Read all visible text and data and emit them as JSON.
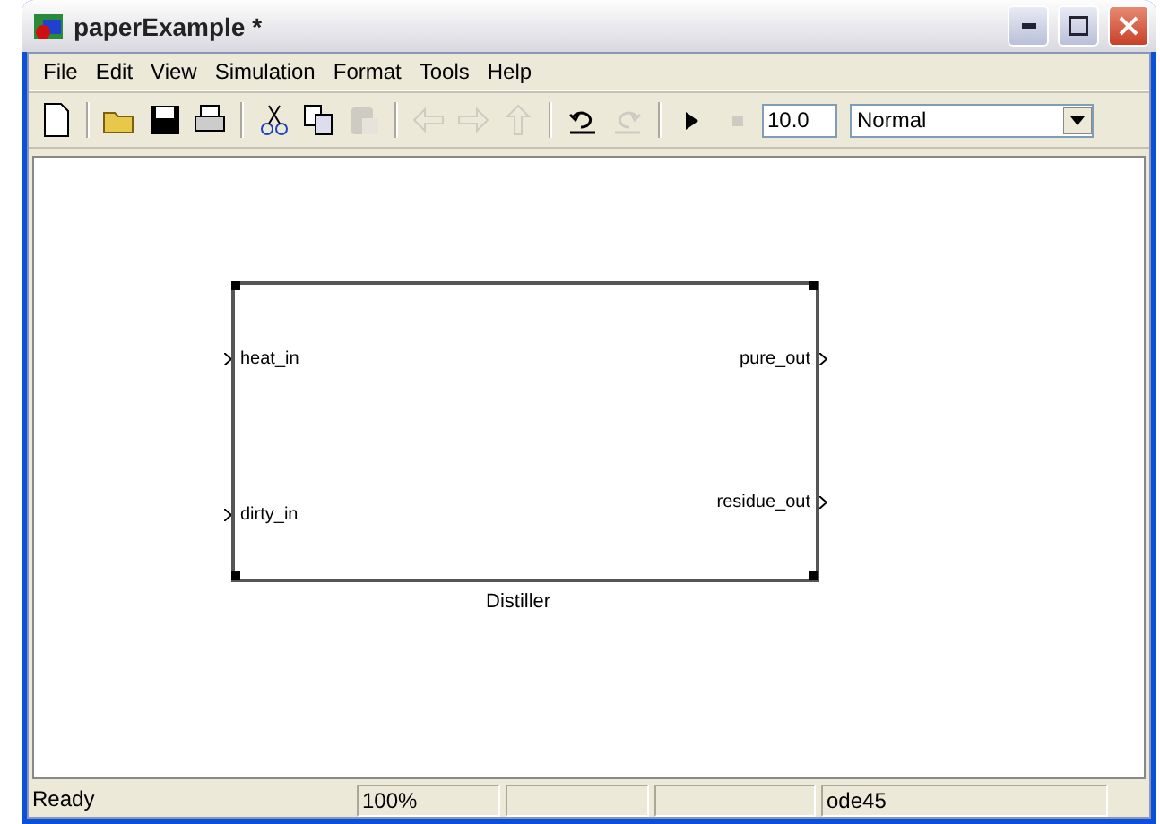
{
  "window": {
    "title": "paperExample *"
  },
  "menu": [
    "File",
    "Edit",
    "View",
    "Simulation",
    "Format",
    "Tools",
    "Help"
  ],
  "toolbar": [
    {
      "kind": "new",
      "disabled": false
    },
    {
      "kind": "sep"
    },
    {
      "kind": "open",
      "disabled": false
    },
    {
      "kind": "save",
      "disabled": false
    },
    {
      "kind": "print",
      "disabled": false
    },
    {
      "kind": "sep"
    },
    {
      "kind": "cut",
      "disabled": false
    },
    {
      "kind": "copy",
      "disabled": false
    },
    {
      "kind": "paste",
      "disabled": true
    },
    {
      "kind": "sep"
    },
    {
      "kind": "back",
      "disabled": true
    },
    {
      "kind": "forward",
      "disabled": true
    },
    {
      "kind": "up",
      "disabled": true
    },
    {
      "kind": "sep"
    },
    {
      "kind": "undo",
      "disabled": false
    },
    {
      "kind": "redo",
      "disabled": true
    },
    {
      "kind": "sep"
    },
    {
      "kind": "play",
      "disabled": false
    },
    {
      "kind": "stop",
      "disabled": true
    }
  ],
  "stop_time": "10.0",
  "mode": "Normal",
  "block": {
    "name": "Distiller",
    "inputs": [
      "heat_in",
      "dirty_in"
    ],
    "outputs": [
      "pure_out",
      "residue_out"
    ]
  },
  "status_bar": {
    "message": "Ready",
    "zoom": "100%",
    "solver": "ode45"
  }
}
